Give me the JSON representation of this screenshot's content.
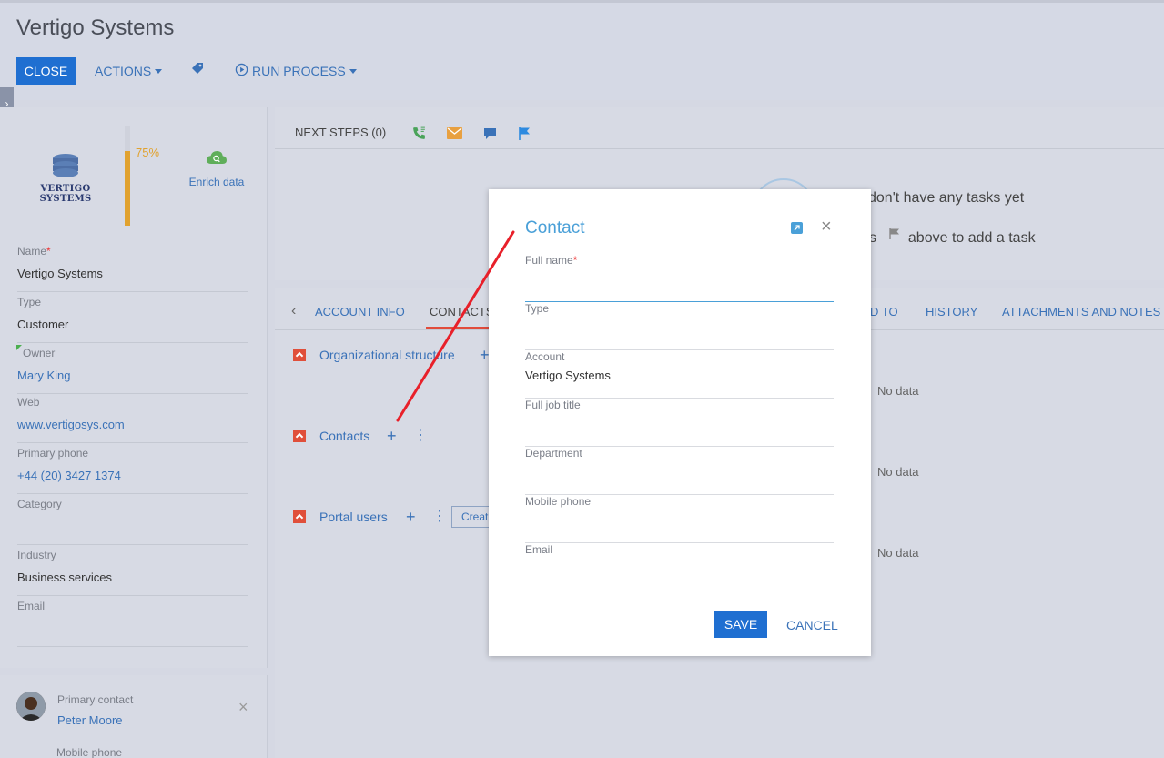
{
  "page": {
    "title": "Vertigo Systems"
  },
  "toolbar": {
    "close_label": "CLOSE",
    "actions_label": "ACTIONS",
    "run_process_label": "RUN PROCESS"
  },
  "profile": {
    "logo_text": "VERTIGO SYSTEMS",
    "completeness": "75%",
    "completeness_fraction": 0.75,
    "enrich_label": "Enrich data"
  },
  "fields": {
    "name": {
      "label": "Name",
      "value": "Vertigo Systems",
      "required_mark": "*"
    },
    "type": {
      "label": "Type",
      "value": "Customer"
    },
    "owner": {
      "label": "Owner",
      "value": "Mary King"
    },
    "web": {
      "label": "Web",
      "value": "www.vertigosys.com"
    },
    "phone": {
      "label": "Primary phone",
      "value": "+44 (20) 3427 1374"
    },
    "category": {
      "label": "Category",
      "value": ""
    },
    "industry": {
      "label": "Industry",
      "value": "Business services"
    },
    "email": {
      "label": "Email",
      "value": ""
    }
  },
  "primary_contact": {
    "label": "Primary contact",
    "name": "Peter Moore",
    "mobile_label": "Mobile phone"
  },
  "next_steps": {
    "title": "NEXT STEPS (0)",
    "empty_line1": "don't have any tasks yet",
    "empty_line2_prefix": "s",
    "empty_line2_suffix": "above to add a task"
  },
  "tabs": {
    "account_info": "ACCOUNT INFO",
    "contacts": "CONTACTS",
    "related_to": "D TO",
    "history": "HISTORY",
    "attachments": "ATTACHMENTS AND NOTES"
  },
  "sections": {
    "org_structure": "Organizational structure",
    "contacts": "Contacts",
    "portal_users": "Portal users",
    "create_label": "Creat",
    "no_data": "No data"
  },
  "modal": {
    "title": "Contact",
    "full_name": {
      "label": "Full name",
      "required_mark": "*",
      "value": ""
    },
    "type": {
      "label": "Type",
      "value": ""
    },
    "account": {
      "label": "Account",
      "value": "Vertigo Systems"
    },
    "job_title": {
      "label": "Full job title",
      "value": ""
    },
    "department": {
      "label": "Department",
      "value": ""
    },
    "mobile": {
      "label": "Mobile phone",
      "value": ""
    },
    "email": {
      "label": "Email",
      "value": ""
    },
    "save_label": "SAVE",
    "cancel_label": "CANCEL"
  },
  "colors": {
    "accent": "#1f6fd1",
    "link": "#3a72b8",
    "progress": "#e1a22f",
    "section_icon": "#e04f3a",
    "annotation_line": "#e8202a"
  }
}
